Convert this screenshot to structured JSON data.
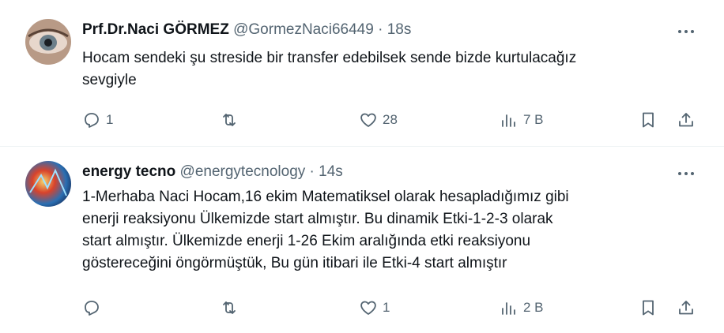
{
  "tweets": [
    {
      "author_name": "Prf.Dr.Naci GÖRMEZ",
      "handle": "@GormezNaci66449",
      "separator": "·",
      "time": "18s",
      "text_lines": [
        "Hocam sendeki şu streside bir transfer edebilsek sende bizde kurtulacağız",
        "sevgiyle"
      ],
      "replies": "1",
      "retweets": "",
      "likes": "28",
      "views": "7 B"
    },
    {
      "author_name": "energy tecno",
      "handle": "@energytecnology",
      "separator": "·",
      "time": "14s",
      "text_lines": [
        "1-Merhaba Naci Hocam,16 ekim Matematiksel olarak hesapladığımız gibi",
        "enerji reaksiyonu Ülkemizde start almıştır. Bu dinamik Etki-1-2-3 olarak",
        "start almıştır. Ülkemizde enerji 1-26 Ekim aralığında etki reaksiyonu",
        "göstereceğini öngörmüştük, Bu gün itibari ile Etki-4 start almıştır"
      ],
      "replies": "",
      "retweets": "",
      "likes": "1",
      "views": "2 B"
    }
  ],
  "icons": {
    "more": "more-horizontal-icon",
    "reply": "reply-icon",
    "retweet": "retweet-icon",
    "like": "heart-icon",
    "views": "views-icon",
    "bookmark": "bookmark-icon",
    "share": "share-icon"
  },
  "colors": {
    "text": "#0f1419",
    "secondary": "#536471",
    "divider": "#eff3f4"
  }
}
